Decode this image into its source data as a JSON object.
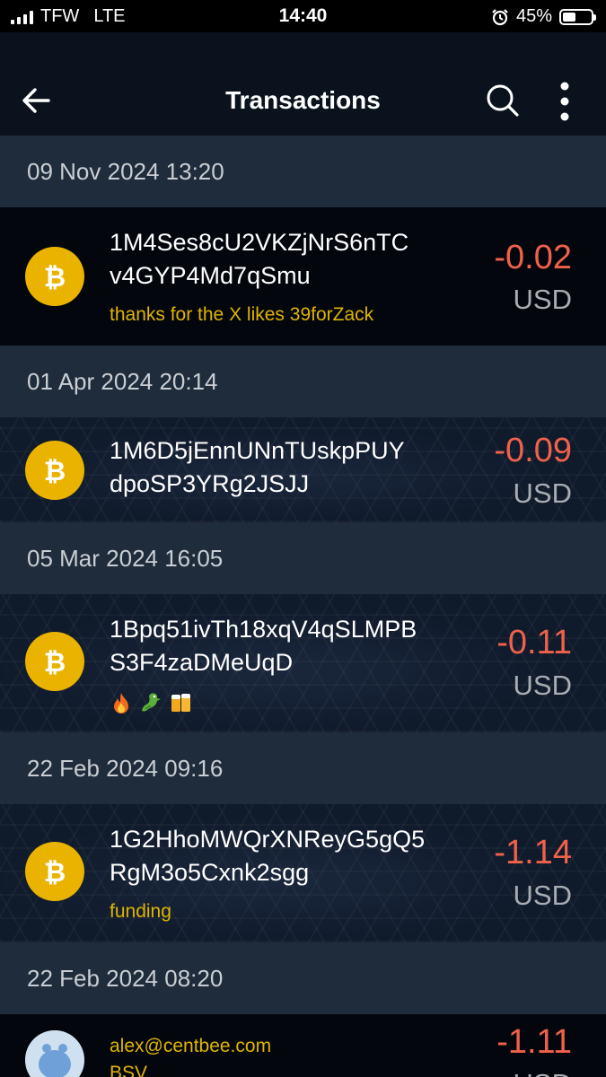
{
  "status_bar": {
    "carrier": "TFW",
    "network": "LTE",
    "time": "14:40",
    "battery_percent": "45%",
    "battery_level": 0.45
  },
  "header": {
    "title": "Transactions",
    "back_icon": "arrow-left-icon",
    "search_icon": "search-icon",
    "more_icon": "more-vertical-icon"
  },
  "colors": {
    "coin": "#eab300",
    "negative_amount": "#f0614b",
    "memo": "#e0b400"
  },
  "groups": [
    {
      "date": "09 Nov 2024 13:20",
      "tx": {
        "address_line1": "1M4Ses8cU2VKZjNrS6nTC",
        "address_line2": "v4GYP4Md7qSmu",
        "memo": "thanks for the X likes 39forZack",
        "amount": "-0.02",
        "currency": "USD",
        "icon": "bitcoin-icon"
      }
    },
    {
      "date": "01 Apr 2024 20:14",
      "tx": {
        "address_line1": "1M6D5jEnnUNnTUskpPUY",
        "address_line2": "dpoSP3YRg2JSJJ",
        "memo": "",
        "amount": "-0.09",
        "currency": "USD",
        "icon": "bitcoin-icon"
      }
    },
    {
      "date": "05 Mar 2024 16:05",
      "tx": {
        "address_line1": "1Bpq51ivTh18xqV4qSLMPB",
        "address_line2": "S3F4zaDMeUqD",
        "memo_emojis": [
          "fire-emoji",
          "dragon-emoji",
          "beer-emoji"
        ],
        "amount": "-0.11",
        "currency": "USD",
        "icon": "bitcoin-icon"
      }
    },
    {
      "date": "22 Feb 2024 09:16",
      "tx": {
        "address_line1": "1G2HhoMWQrXNReyG5gQ5",
        "address_line2": "RgM3o5Cxnk2sgg",
        "memo": "funding",
        "amount": "-1.14",
        "currency": "USD",
        "icon": "bitcoin-icon"
      }
    },
    {
      "date": "22 Feb 2024 08:20",
      "tx": {
        "address_line1": "alex@centbee.com",
        "address_line2": "BSV",
        "amount": "-1.11",
        "currency": "USD",
        "icon": "user-avatar-icon"
      }
    }
  ]
}
